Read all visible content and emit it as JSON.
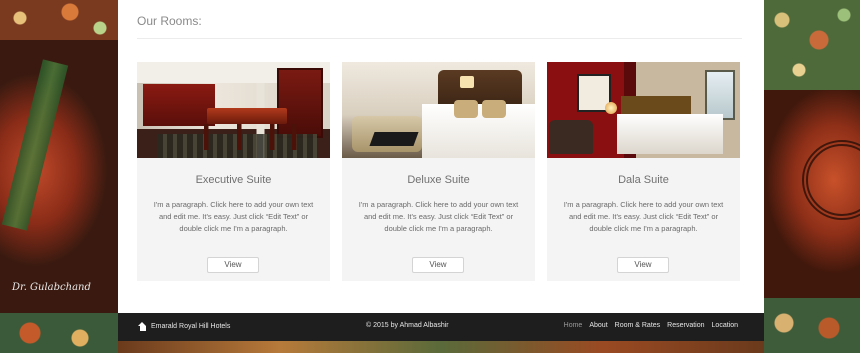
{
  "section": {
    "title": "Our Rooms:"
  },
  "rooms": [
    {
      "name": "Executive Suite",
      "description": "I'm a paragraph. Click here to add your own text and edit me. It's easy. Just click “Edit Text” or double click me I'm a paragraph.",
      "button_label": "View"
    },
    {
      "name": "Deluxe Suite",
      "description": "I'm a paragraph. Click here to add your own text and edit me. It's easy. Just click “Edit Text” or double click me I'm a paragraph.",
      "button_label": "View"
    },
    {
      "name": "Dala Suite",
      "description": "I'm a paragraph. Click here to add your own text and edit me. It's easy. Just click “Edit Text” or double click me I'm a paragraph.",
      "button_label": "View"
    }
  ],
  "footer": {
    "brand": "Emarald Royal Hill Hotels",
    "brand_icon": "home-icon",
    "copyright": "© 2015 by Ahmad Albashir",
    "nav": [
      {
        "label": "Home",
        "active": true
      },
      {
        "label": "About",
        "active": false
      },
      {
        "label": "Room & Rates",
        "active": false
      },
      {
        "label": "Reservation",
        "active": false
      },
      {
        "label": "Location",
        "active": false
      }
    ]
  },
  "background": {
    "signature": "Dr. Gulabchand"
  },
  "colors": {
    "panel": "#ffffff",
    "card": "#f4f4f4",
    "footer": "#1e1e1e",
    "accent_red": "#8a0f10"
  }
}
